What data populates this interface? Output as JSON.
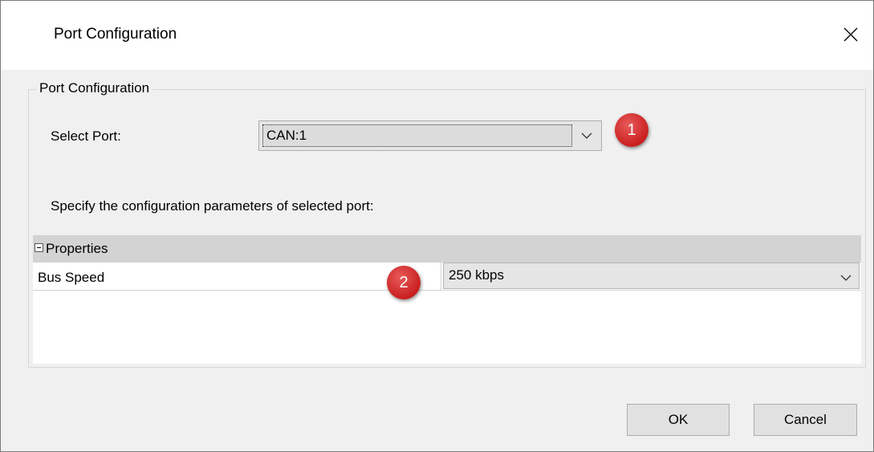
{
  "window": {
    "title": "Port Configuration",
    "close_icon": "close-icon"
  },
  "group": {
    "legend": "Port Configuration"
  },
  "port": {
    "label": "Select Port:",
    "selected": "CAN:1"
  },
  "description": "Specify the configuration parameters of selected port:",
  "properties": {
    "header": "Properties",
    "rows": [
      {
        "name": "Bus Speed",
        "value": "250 kbps"
      }
    ]
  },
  "annotations": {
    "badge_1": "1",
    "badge_2": "2",
    "badge_color": "#c91f1f"
  },
  "buttons": {
    "ok": "OK",
    "cancel": "Cancel"
  }
}
